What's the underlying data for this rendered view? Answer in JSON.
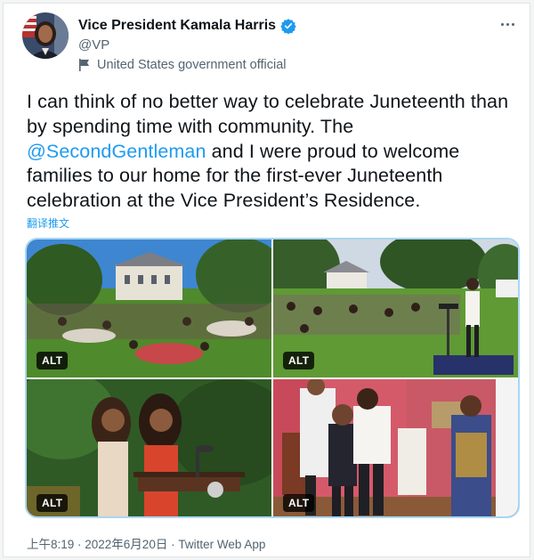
{
  "tweet": {
    "author_name": "Vice President Kamala Harris",
    "handle": "@VP",
    "gov_label": "United States government official",
    "text_part1": "I can think of no better way to celebrate Juneteenth than by spending time with community. The ",
    "mention": "@SecondGentleman",
    "text_part2": " and I were proud to welcome families to our home for the first-ever Juneteenth celebration at the Vice President’s Residence.",
    "translate_label": "翻译推文",
    "timestamp": "上午8:19 · 2022年6月20日",
    "separator": "·",
    "source": "Twitter Web App"
  },
  "media": {
    "photos": [
      {
        "alt_badge": "ALT",
        "icon": "photo-garden-party-residence"
      },
      {
        "alt_badge": "ALT",
        "icon": "photo-speaker-podium-crowd"
      },
      {
        "alt_badge": "ALT",
        "icon": "photo-performers-at-podium"
      },
      {
        "alt_badge": "ALT",
        "icon": "photo-hug-in-residence"
      }
    ]
  },
  "colors": {
    "link": "#1d9bf0",
    "verified": "#1d9bf0",
    "secondary_text": "#536471",
    "media_border": "#a9d6f3"
  }
}
